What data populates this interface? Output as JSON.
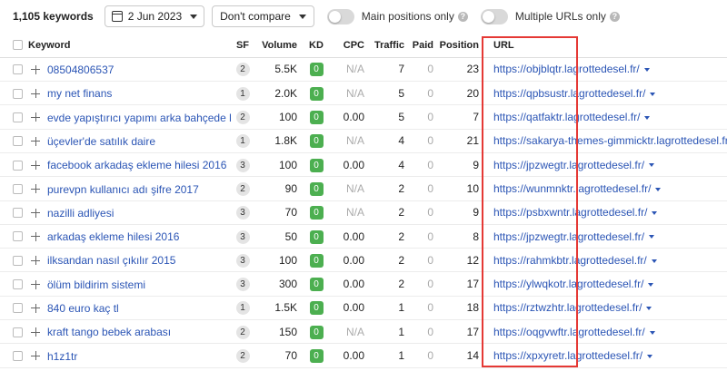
{
  "toolbar": {
    "keywords_count": "1,105 keywords",
    "date_label": "2 Jun 2023",
    "compare_label": "Don't compare",
    "main_positions_label": "Main positions only",
    "multiple_urls_label": "Multiple URLs only",
    "help_glyph": "?"
  },
  "table": {
    "headers": {
      "keyword": "Keyword",
      "sf": "SF",
      "volume": "Volume",
      "kd": "KD",
      "cpc": "CPC",
      "traffic": "Traffic",
      "paid": "Paid",
      "position": "Position",
      "url": "URL"
    },
    "rows": [
      {
        "keyword": "08504806537",
        "sf": "2",
        "volume": "5.5K",
        "kd": "0",
        "cpc": "N/A",
        "traffic": "7",
        "paid": "0",
        "position": "23",
        "url": "https://objblqtr.lagrottedesel.fr/"
      },
      {
        "keyword": "my net finans",
        "sf": "1",
        "volume": "2.0K",
        "kd": "0",
        "cpc": "N/A",
        "traffic": "5",
        "paid": "0",
        "position": "20",
        "url": "https://qpbsustr.lagrottedesel.fr/"
      },
      {
        "keyword": "evde yapıştırıcı yapımı arka bahçede bilim",
        "sf": "2",
        "volume": "100",
        "kd": "0",
        "cpc": "0.00",
        "traffic": "5",
        "paid": "0",
        "position": "7",
        "url": "https://qatfaktr.lagrottedesel.fr/"
      },
      {
        "keyword": "üçevler'de satılık daire",
        "sf": "1",
        "volume": "1.8K",
        "kd": "0",
        "cpc": "N/A",
        "traffic": "4",
        "paid": "0",
        "position": "21",
        "url": "https://sakarya-themes-gimmicktr.lagrottedesel.fr/"
      },
      {
        "keyword": "facebook arkadaş ekleme hilesi 2016",
        "sf": "3",
        "volume": "100",
        "kd": "0",
        "cpc": "0.00",
        "traffic": "4",
        "paid": "0",
        "position": "9",
        "url": "https://jpzwegtr.lagrottedesel.fr/"
      },
      {
        "keyword": "purevpn kullanıcı adı şifre 2017",
        "sf": "2",
        "volume": "90",
        "kd": "0",
        "cpc": "N/A",
        "traffic": "2",
        "paid": "0",
        "position": "10",
        "url": "https://wunmnktr.lagrottedesel.fr/"
      },
      {
        "keyword": "nazilli adliyesi",
        "sf": "3",
        "volume": "70",
        "kd": "0",
        "cpc": "N/A",
        "traffic": "2",
        "paid": "0",
        "position": "9",
        "url": "https://psbxwntr.lagrottedesel.fr/"
      },
      {
        "keyword": "arkadaş ekleme hilesi 2016",
        "sf": "3",
        "volume": "50",
        "kd": "0",
        "cpc": "0.00",
        "traffic": "2",
        "paid": "0",
        "position": "8",
        "url": "https://jpzwegtr.lagrottedesel.fr/"
      },
      {
        "keyword": "ilksandan nasıl çıkılır 2015",
        "sf": "3",
        "volume": "100",
        "kd": "0",
        "cpc": "0.00",
        "traffic": "2",
        "paid": "0",
        "position": "12",
        "url": "https://rahmkbtr.lagrottedesel.fr/"
      },
      {
        "keyword": "ölüm bildirim sistemi",
        "sf": "3",
        "volume": "300",
        "kd": "0",
        "cpc": "0.00",
        "traffic": "2",
        "paid": "0",
        "position": "17",
        "url": "https://ylwqkotr.lagrottedesel.fr/"
      },
      {
        "keyword": "840 euro kaç tl",
        "sf": "1",
        "volume": "1.5K",
        "kd": "0",
        "cpc": "0.00",
        "traffic": "1",
        "paid": "0",
        "position": "18",
        "url": "https://rztwzhtr.lagrottedesel.fr/"
      },
      {
        "keyword": "kraft tango bebek arabası",
        "sf": "2",
        "volume": "150",
        "kd": "0",
        "cpc": "N/A",
        "traffic": "1",
        "paid": "0",
        "position": "17",
        "url": "https://oqgvwftr.lagrottedesel.fr/"
      },
      {
        "keyword": "h1z1tr",
        "sf": "2",
        "volume": "70",
        "kd": "0",
        "cpc": "0.00",
        "traffic": "1",
        "paid": "0",
        "position": "14",
        "url": "https://xpxyretr.lagrottedesel.fr/"
      }
    ]
  },
  "colors": {
    "link": "#2b55b5",
    "kd_badge": "#4caf50",
    "highlight_border": "#e53935"
  }
}
